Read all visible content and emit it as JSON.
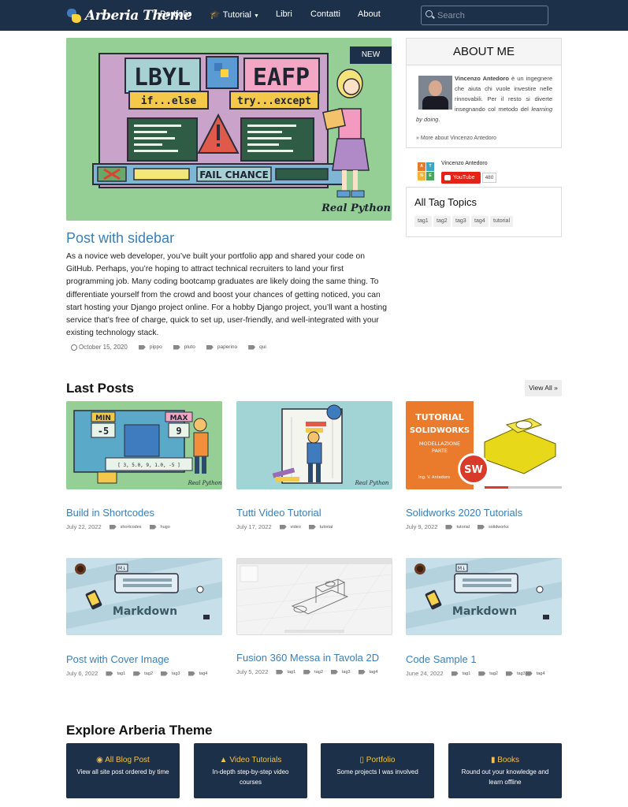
{
  "navbar": {
    "brand": "Arberia Theme",
    "items": [
      {
        "label": "Portfolio",
        "icon": ""
      },
      {
        "label": "Tutorial",
        "icon": "graduation-cap-icon",
        "dropdown": true
      },
      {
        "label": "Libri",
        "icon": ""
      },
      {
        "label": "Contatti",
        "icon": ""
      },
      {
        "label": "About",
        "icon": ""
      }
    ],
    "search_placeholder": "Search"
  },
  "featured": {
    "badge": "NEW",
    "image_text": {
      "lbyl": "LBYL",
      "eafp": "EAFP",
      "if_else": "if...else",
      "try_except": "try...except",
      "fail_chance": "FAIL CHANCE",
      "brand": "Real Python"
    },
    "title": "Post with sidebar",
    "excerpt": "As a novice web developer, you’ve built your portfolio app and shared your code on GitHub. Perhaps, you’re hoping to attract technical recruiters to land your first programming job. Many coding bootcamp graduates are likely doing the same thing. To differentiate yourself from the crowd and boost your chances of getting noticed, you can start hosting your Django project online. For a hobby Django project, you’ll want a hosting service that’s free of charge, quick to set up, user-friendly, and well-integrated with your existing technology stack.",
    "date": "October 15, 2020",
    "tags": [
      "pippo",
      "pluto",
      "paperino",
      "qui"
    ]
  },
  "sidebar": {
    "about_title": "ABOUT ME",
    "about_name": "Vincenzo Antedoro",
    "about_text_rest": "è un ingegnere che aiuta chi vuole investire nelle rinnovabili. Per il resto si diverte insegnando col metodo del",
    "about_text_em": "learning by doing",
    "about_more": "» More about Vincenzo Antedoro",
    "youtube": {
      "logo_letters": [
        "A",
        "T",
        "N",
        "E"
      ],
      "channel": "Vincenzo Antedoro",
      "button": "YouTube",
      "count": "480"
    },
    "tags_title": "All Tag Topics",
    "tags": [
      "tag1",
      "tag2",
      "tag3",
      "tag4",
      "tutorial"
    ]
  },
  "last_posts": {
    "title": "Last Posts",
    "view_all": "View All »",
    "posts": [
      {
        "title": "Build in Shortcodes",
        "date": "July 22, 2022",
        "tags": [
          "shortcodes",
          "hugo"
        ],
        "image_text": {
          "min": "MIN",
          "max": "MAX",
          "v1": "-5",
          "v2": "9",
          "list": "[ 3, 5.0, 9, 1.0, -5 ]",
          "brand": "Real Python"
        }
      },
      {
        "title": "Tutti Video Tutorial",
        "date": "July 17, 2022",
        "tags": [
          "video",
          "tutorial"
        ],
        "image_text": {
          "brand": "Real Python"
        }
      },
      {
        "title": "Solidworks 2020 Tutorials",
        "date": "July 9, 2022",
        "tags": [
          "tutorial",
          "solidworks"
        ],
        "image_text": {
          "line1": "TUTORIAL",
          "line2": "SOLIDWORKS",
          "line3": "MODELLAZIONE",
          "line4": "PARTE",
          "author": "Ing. V. Antedoro",
          "logo": "SW"
        }
      },
      {
        "title": "Post with Cover Image",
        "date": "July 6, 2022",
        "tags": [
          "tag1",
          "tag2",
          "tag3",
          "tag4"
        ],
        "image_text": {
          "label": "Markdown",
          "key": "M↓"
        }
      },
      {
        "title": "Fusion 360 Messa in Tavola 2D",
        "date": "July 5, 2022",
        "tags": [
          "tag1",
          "tag2",
          "tag3",
          "tag4"
        ],
        "image_text": {}
      },
      {
        "title": "Code Sample 1",
        "date": "June 24, 2022",
        "tags": [
          "tag1",
          "tag2",
          "tag3",
          "tag4"
        ],
        "image_text": {
          "label": "Markdown",
          "key": "M↓"
        }
      }
    ]
  },
  "explore": {
    "title": "Explore Arberia Theme",
    "boxes": [
      {
        "icon": "rss-icon",
        "glyph": "◉",
        "title": "All Blog Post",
        "desc": "View all site post ordered by time"
      },
      {
        "icon": "graduation-cap-icon",
        "glyph": "▲",
        "title": "Video Tutorials",
        "desc": "In-depth step-by-step video courses"
      },
      {
        "icon": "map-icon",
        "glyph": "▯",
        "title": "Portfolio",
        "desc": "Some projects I was involved"
      },
      {
        "icon": "book-icon",
        "glyph": "▮",
        "title": "Books",
        "desc": "Round out your knowledge and learn offline"
      }
    ]
  },
  "colors": {
    "navbar": "#1d3049",
    "link": "#3a7fb8",
    "accent": "#f2c14e",
    "hero_bg": "#95cf95"
  }
}
